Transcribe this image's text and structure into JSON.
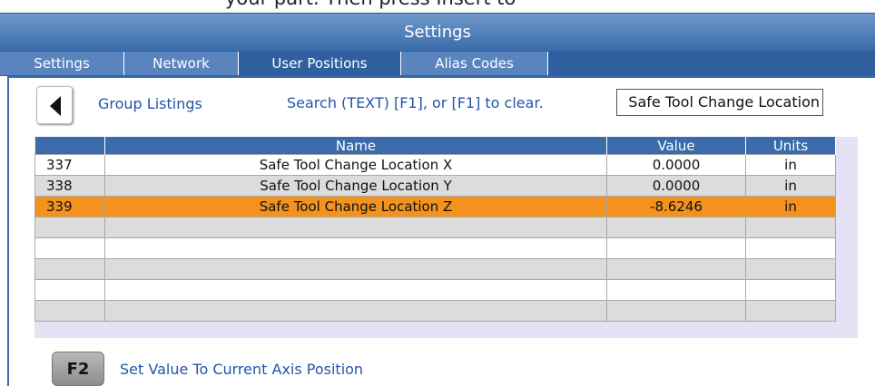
{
  "top_text": "your part. Then press Insert to",
  "window": {
    "title": "Settings"
  },
  "tabs": [
    {
      "label": "Settings",
      "active": false
    },
    {
      "label": "Network",
      "active": false
    },
    {
      "label": "User Positions",
      "active": true
    },
    {
      "label": "Alias Codes",
      "active": false
    }
  ],
  "toolbar": {
    "back_icon": "triangle-left-icon",
    "group_listings": "Group Listings",
    "search_hint": "Search (TEXT) [F1], or [F1] to clear.",
    "search_value": "Safe Tool Change Location"
  },
  "table": {
    "columns": [
      "",
      "Name",
      "Value",
      "Units"
    ],
    "rows": [
      {
        "num": "337",
        "name": "Safe Tool Change Location X",
        "value": "0.0000",
        "units": "in"
      },
      {
        "num": "338",
        "name": "Safe Tool Change Location Y",
        "value": "0.0000",
        "units": "in"
      },
      {
        "num": "339",
        "name": "Safe Tool Change Location Z",
        "value": "-8.6246",
        "units": "in",
        "selected": true
      }
    ],
    "empty_rows": 5
  },
  "footer": {
    "key": "F2",
    "label": "Set Value To Current Axis Position"
  },
  "colors": {
    "header_blue": "#3a6cab",
    "selection": "#f3921d",
    "link_text": "#2255aa"
  }
}
